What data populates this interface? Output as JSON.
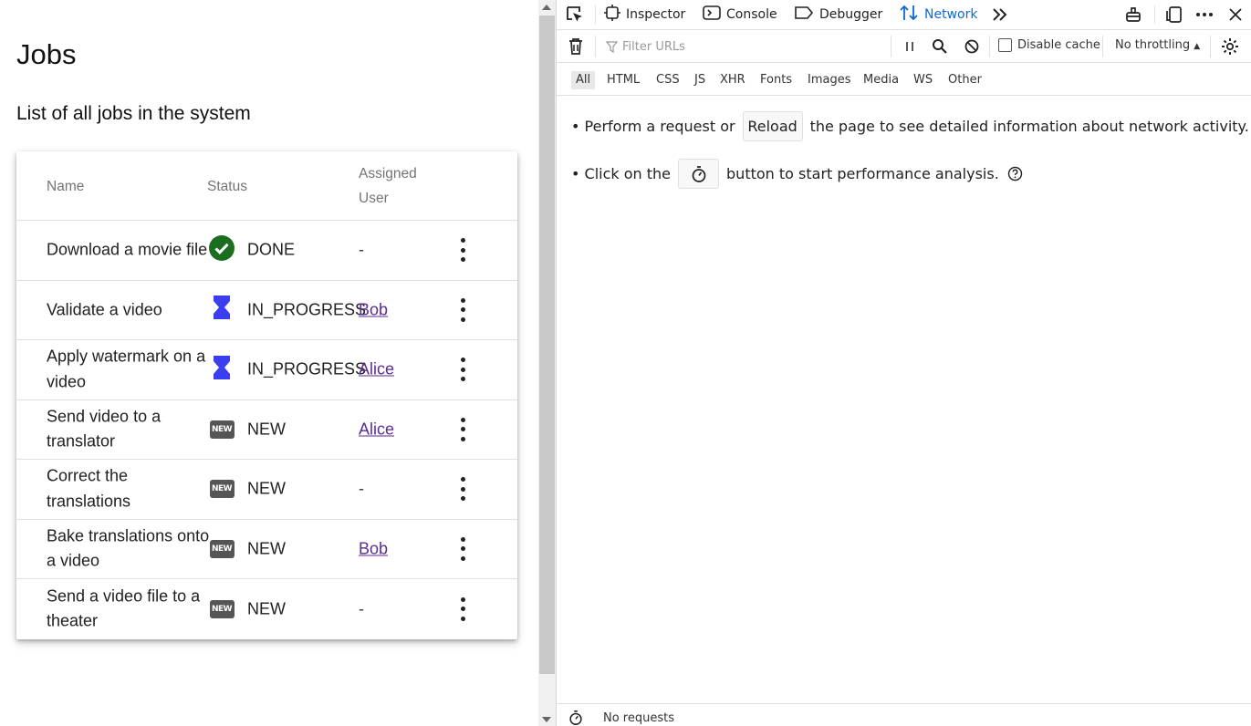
{
  "app": {
    "title": "Jobs",
    "subtitle": "List of all jobs in the system",
    "columns": {
      "name": "Name",
      "status": "Status",
      "user": "Assigned User"
    },
    "jobs": [
      {
        "name": "Download a movie file",
        "status": "DONE",
        "status_icon": "check-circle-icon",
        "user": "-"
      },
      {
        "name": "Validate a video",
        "status": "IN_PROGRESS",
        "status_icon": "hourglass-icon",
        "user": "Bob"
      },
      {
        "name": "Apply watermark on a video",
        "status": "IN_PROGRESS",
        "status_icon": "hourglass-icon",
        "user": "Alice"
      },
      {
        "name": "Send video to a translator",
        "status": "NEW",
        "status_icon": "new-badge-icon",
        "user": "Alice"
      },
      {
        "name": "Correct the translations",
        "status": "NEW",
        "status_icon": "new-badge-icon",
        "user": "-"
      },
      {
        "name": "Bake translations onto a video",
        "status": "NEW",
        "status_icon": "new-badge-icon",
        "user": "Bob"
      },
      {
        "name": "Send a video file to a theater",
        "status": "NEW",
        "status_icon": "new-badge-icon",
        "user": "-"
      }
    ],
    "new_badge_text": "NEW",
    "colors": {
      "done": "#1b6e20",
      "in_progress": "#3b3ef0",
      "new": "#555555",
      "link": "#5b2c8f"
    }
  },
  "devtools": {
    "tabs": {
      "inspector": "Inspector",
      "console": "Console",
      "debugger": "Debugger",
      "network": "Network"
    },
    "active_tab": "Network",
    "filter_placeholder": "Filter URLs",
    "disable_cache": "Disable cache",
    "throttling": "No throttling",
    "types": [
      "All",
      "HTML",
      "CSS",
      "JS",
      "XHR",
      "Fonts",
      "Images",
      "Media",
      "WS",
      "Other"
    ],
    "active_type": "All",
    "msg1_before": "• Perform a request or",
    "msg1_button": "Reload",
    "msg1_after": "the page to see detailed information about network activity.",
    "msg2_before": "• Click on the",
    "msg2_after": "button to start performance analysis.",
    "status": "No requests",
    "accent": "#0b6ad8"
  }
}
